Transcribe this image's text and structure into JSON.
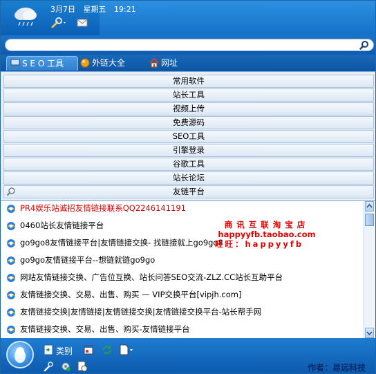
{
  "header": {
    "date": "3月7日",
    "weekday": "星期五",
    "time": "19:21"
  },
  "search": {
    "value": "",
    "placeholder": ""
  },
  "tabs": [
    {
      "label": "S E O 工具"
    },
    {
      "label": "外链大全"
    },
    {
      "label": "网址"
    }
  ],
  "categories": [
    {
      "label": "常用软件"
    },
    {
      "label": "站长工具"
    },
    {
      "label": "视频上传"
    },
    {
      "label": "免费源码"
    },
    {
      "label": "SEO工具"
    },
    {
      "label": "引擎登录"
    },
    {
      "label": "谷歌工具"
    },
    {
      "label": "站长论坛"
    },
    {
      "label": "友链平台"
    }
  ],
  "links": [
    {
      "text": "PR4娱乐站诚招友情链接联系QQ2246141191"
    },
    {
      "text": "0460站长友情链接平台"
    },
    {
      "text": "go9go8友情链接平台|友情链接交换- 找链接就上go9go8"
    },
    {
      "text": "go9go友情链接平台--想链就链go9go"
    },
    {
      "text": "网站友情链接交换、广告位互换、站长问答SEO交流-ZLZ.CC站长互助平台"
    },
    {
      "text": "友情链接交换、交易、出售、购买 — VIP交换平台[vipjh.com]"
    },
    {
      "text": "友情链接交换|友情链接|友情链接交换|友情链接交换平台-站长帮手网"
    },
    {
      "text": "友情链接交换、交易、出售、购买-友情链接平台"
    }
  ],
  "ad": {
    "line1": "商讯互联淘宝店",
    "line2": "happyyfb.taobao.com",
    "line3": "旺旺：happyyfb"
  },
  "bottom": {
    "category_label": "类别",
    "author": "作者：易远科技"
  },
  "colors": {
    "header_blue": "#0b5fb6",
    "link_highlight": "#d40000",
    "ad_red": "#e00000"
  }
}
